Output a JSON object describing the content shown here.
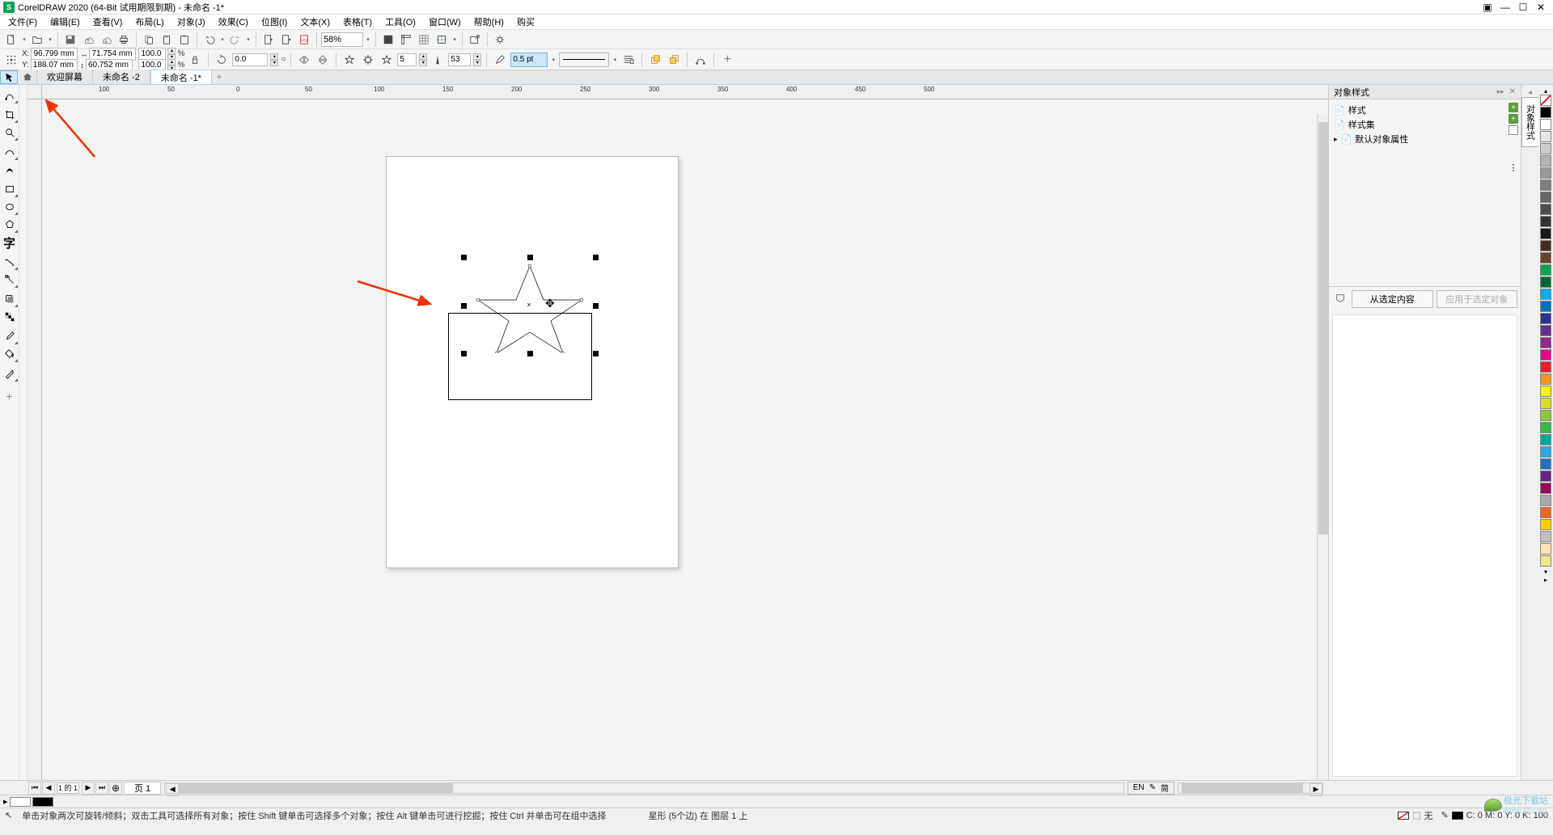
{
  "app": {
    "title": "CorelDRAW 2020 (64-Bit 试用期限到期) - 未命名 -1*"
  },
  "menu": {
    "file": "文件(F)",
    "edit": "编辑(E)",
    "view": "查看(V)",
    "layout": "布局(L)",
    "object": "对象(J)",
    "effects": "效果(C)",
    "bitmap": "位图(I)",
    "text": "文本(X)",
    "table": "表格(T)",
    "tools": "工具(O)",
    "window": "窗口(W)",
    "help": "帮助(H)",
    "buy": "购买"
  },
  "toolbar": {
    "zoom": "58%"
  },
  "props": {
    "x_label": "X:",
    "x": "96.799 mm",
    "y_label": "Y:",
    "y": "188.07 mm",
    "w": "71.754 mm",
    "h": "60.752 mm",
    "scale_x": "100.0",
    "scale_y": "100.0",
    "pct": "%",
    "rotation": "0.0",
    "points": "5",
    "sharpness": "53",
    "outline_width": "0.5 pt"
  },
  "tabs": {
    "welcome": "欢迎屏幕",
    "doc2": "未命名 -2",
    "doc1": "未命名 -1*"
  },
  "ruler": {
    "labels": [
      "100",
      "50",
      "0",
      "50",
      "100",
      "150",
      "200",
      "250",
      "300",
      "350",
      "400",
      "450",
      "500"
    ]
  },
  "dock": {
    "title": "对象样式",
    "item_styles": "样式",
    "item_stylesets": "样式集",
    "item_defaults": "默认对象属性",
    "btn_from_sel": "从选定内容",
    "btn_apply": "应用于选定对象"
  },
  "side_tab": {
    "styles": "对象样式"
  },
  "page_nav": {
    "counter": "1 的 1",
    "page1": "页 1"
  },
  "lang": {
    "lang": "EN",
    "ime": "简"
  },
  "status": {
    "hint": "单击对象两次可旋转/倾斜；双击工具可选择所有对象；按住 Shift 键单击可选择多个对象；按住 Alt 键单击可进行挖掘；按住 Ctrl 并单击可在组中选择",
    "selection": "星形 (5个边) 在 图层 1 上",
    "fill_none": "无",
    "cmyk": "C: 0 M: 0 Y: 0 K: 100"
  },
  "palette": {
    "colors": [
      "#000000",
      "#ffffff",
      "#e6e6e6",
      "#cccccc",
      "#b3b3b3",
      "#999999",
      "#808080",
      "#666666",
      "#4d4d4d",
      "#333333",
      "#1a1a1a",
      "#422f21",
      "#6b4226",
      "#00a651",
      "#006837",
      "#00aeef",
      "#0072bc",
      "#2e3192",
      "#662d91",
      "#92278f",
      "#ec008c",
      "#ed1c24",
      "#f7941d",
      "#fff200",
      "#d7df23",
      "#8dc63f",
      "#39b54a",
      "#00a99d",
      "#27aae1",
      "#1c75bc",
      "#662483",
      "#9e005d",
      "#a7a9ac",
      "#f26522",
      "#ffcc00",
      "#c0c0c0",
      "#ffe0b0",
      "#f0e68c"
    ]
  },
  "watermark": {
    "text1": "极光下载站",
    "text2": "www.xz7.co"
  }
}
